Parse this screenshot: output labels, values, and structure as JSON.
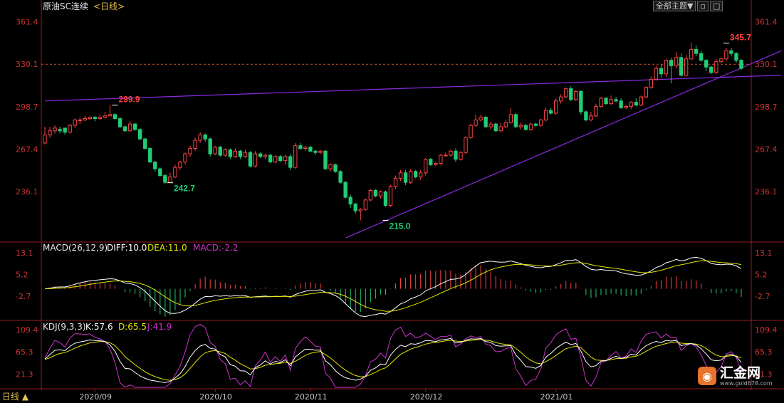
{
  "header": {
    "symbol": "原油SC连续",
    "period": "<日线>",
    "theme_label": "全部主题▼",
    "icon_names": [
      "restore-icon",
      "maximize-icon"
    ]
  },
  "bottom_tab": "日线 ▲",
  "logo": {
    "name": "汇金网",
    "url": "www.gold678.com"
  },
  "colors": {
    "up": "#ff4444",
    "down": "#22cc77",
    "trend": "#8a2be2",
    "diff": "#ffffff",
    "dea": "#e6e600",
    "macd_label": "#cc33cc",
    "axis": "#cc3333",
    "date": "#c8c8c8",
    "dashed": "#cc5522"
  },
  "chart_data": [
    {
      "type": "candlestick",
      "panel": "price",
      "y_ticks": [
        361.4,
        330.1,
        298.7,
        267.4,
        236.1
      ],
      "ylim": [
        200,
        368
      ],
      "current_price_line": 330.1,
      "annotations": [
        {
          "text": "299.9",
          "value": 299.9,
          "index": 14,
          "kind": "high"
        },
        {
          "text": "242.7",
          "value": 242.7,
          "index": 25,
          "kind": "low"
        },
        {
          "text": "215.0",
          "value": 215.0,
          "index": 68,
          "kind": "low"
        },
        {
          "text": "345.7",
          "value": 345.7,
          "index": 136,
          "kind": "high"
        }
      ],
      "trendlines": [
        {
          "i1": 0,
          "v1": 303,
          "i2": 147,
          "v2": 322
        },
        {
          "i1": 60,
          "v1": 202,
          "i2": 147,
          "v2": 340
        }
      ],
      "candles": [
        [
          272,
          278,
          284,
          271
        ],
        [
          278,
          281,
          284,
          276
        ],
        [
          281,
          283,
          285,
          279
        ],
        [
          282,
          281,
          284,
          279
        ],
        [
          283,
          280,
          283,
          278
        ],
        [
          280,
          285,
          286,
          279
        ],
        [
          285,
          289,
          290,
          283
        ],
        [
          289,
          289,
          291,
          286
        ],
        [
          289,
          290,
          292,
          288
        ],
        [
          290,
          291,
          292,
          289
        ],
        [
          291,
          290,
          292,
          288
        ],
        [
          290,
          291,
          293,
          289
        ],
        [
          291,
          292,
          295,
          290
        ],
        [
          292,
          293,
          300,
          292
        ],
        [
          293,
          290,
          294,
          289
        ],
        [
          290,
          284,
          291,
          283
        ],
        [
          284,
          281,
          285,
          280
        ],
        [
          281,
          286,
          288,
          280
        ],
        [
          286,
          282,
          287,
          281
        ],
        [
          282,
          275,
          283,
          274
        ],
        [
          275,
          268,
          276,
          267
        ],
        [
          268,
          258,
          269,
          257
        ],
        [
          258,
          253,
          259,
          251
        ],
        [
          253,
          248,
          254,
          247
        ],
        [
          248,
          243,
          249,
          242
        ],
        [
          243,
          247,
          250,
          243
        ],
        [
          247,
          254,
          256,
          246
        ],
        [
          254,
          258,
          259,
          252
        ],
        [
          258,
          264,
          265,
          256
        ],
        [
          264,
          268,
          270,
          262
        ],
        [
          268,
          274,
          276,
          266
        ],
        [
          274,
          278,
          280,
          272
        ],
        [
          278,
          275,
          279,
          273
        ],
        [
          275,
          264,
          276,
          262
        ],
        [
          264,
          269,
          270,
          263
        ],
        [
          269,
          263,
          270,
          262
        ],
        [
          263,
          267,
          268,
          262
        ],
        [
          267,
          262,
          268,
          260
        ],
        [
          262,
          266,
          268,
          261
        ],
        [
          266,
          262,
          267,
          260
        ],
        [
          262,
          265,
          267,
          261
        ],
        [
          265,
          255,
          266,
          254
        ],
        [
          255,
          264,
          266,
          254
        ],
        [
          264,
          262,
          265,
          261
        ],
        [
          262,
          263,
          264,
          260
        ],
        [
          263,
          258,
          264,
          257
        ],
        [
          258,
          262,
          263,
          257
        ],
        [
          262,
          259,
          263,
          258
        ],
        [
          259,
          262,
          263,
          256
        ],
        [
          262,
          254,
          264,
          252
        ],
        [
          254,
          270,
          272,
          253
        ],
        [
          270,
          268,
          272,
          267
        ],
        [
          268,
          269,
          270,
          266
        ],
        [
          269,
          266,
          270,
          265
        ],
        [
          266,
          265,
          267,
          263
        ],
        [
          265,
          266,
          267,
          264
        ],
        [
          266,
          253,
          267,
          252
        ],
        [
          253,
          256,
          257,
          251
        ],
        [
          256,
          251,
          257,
          250
        ],
        [
          251,
          243,
          252,
          242
        ],
        [
          243,
          232,
          244,
          231
        ],
        [
          232,
          227,
          234,
          224
        ],
        [
          227,
          222,
          228,
          220
        ],
        [
          222,
          223,
          224,
          215
        ],
        [
          223,
          230,
          231,
          222
        ],
        [
          230,
          237,
          238,
          229
        ],
        [
          237,
          233,
          238,
          232
        ],
        [
          233,
          236,
          237,
          231
        ],
        [
          236,
          226,
          237,
          225
        ],
        [
          226,
          240,
          241,
          225
        ],
        [
          240,
          246,
          248,
          238
        ],
        [
          246,
          250,
          252,
          244
        ],
        [
          250,
          243,
          252,
          241
        ],
        [
          243,
          251,
          253,
          242
        ],
        [
          251,
          247,
          252,
          246
        ],
        [
          247,
          250,
          252,
          245
        ],
        [
          250,
          260,
          261,
          248
        ],
        [
          260,
          256,
          261,
          255
        ],
        [
          256,
          257,
          258,
          255
        ],
        [
          257,
          263,
          264,
          256
        ],
        [
          263,
          263,
          265,
          262
        ],
        [
          263,
          266,
          267,
          262
        ],
        [
          266,
          260,
          268,
          258
        ],
        [
          260,
          265,
          266,
          259
        ],
        [
          265,
          276,
          277,
          264
        ],
        [
          276,
          285,
          286,
          275
        ],
        [
          285,
          289,
          293,
          284
        ],
        [
          289,
          291,
          293,
          288
        ],
        [
          291,
          284,
          292,
          283
        ],
        [
          284,
          286,
          288,
          282
        ],
        [
          286,
          281,
          287,
          280
        ],
        [
          281,
          284,
          287,
          280
        ],
        [
          284,
          287,
          289,
          283
        ],
        [
          287,
          293,
          298,
          286
        ],
        [
          293,
          284,
          294,
          283
        ],
        [
          284,
          285,
          287,
          282
        ],
        [
          285,
          282,
          286,
          281
        ],
        [
          282,
          286,
          287,
          281
        ],
        [
          286,
          285,
          287,
          284
        ],
        [
          285,
          289,
          290,
          284
        ],
        [
          289,
          296,
          298,
          288
        ],
        [
          296,
          294,
          298,
          293
        ],
        [
          294,
          303,
          305,
          293
        ],
        [
          303,
          306,
          308,
          301
        ],
        [
          306,
          312,
          313,
          305
        ],
        [
          312,
          304,
          314,
          303
        ],
        [
          304,
          310,
          311,
          303
        ],
        [
          310,
          295,
          311,
          293
        ],
        [
          295,
          289,
          296,
          288
        ],
        [
          289,
          292,
          295,
          288
        ],
        [
          292,
          299,
          301,
          291
        ],
        [
          299,
          305,
          306,
          298
        ],
        [
          305,
          301,
          306,
          300
        ],
        [
          301,
          304,
          307,
          300
        ],
        [
          304,
          303,
          306,
          302
        ],
        [
          303,
          298,
          305,
          297
        ],
        [
          298,
          299,
          300,
          297
        ],
        [
          299,
          302,
          303,
          297
        ],
        [
          302,
          300,
          305,
          299
        ],
        [
          300,
          306,
          307,
          299
        ],
        [
          306,
          313,
          314,
          305
        ],
        [
          313,
          319,
          321,
          312
        ],
        [
          319,
          327,
          329,
          318
        ],
        [
          327,
          323,
          330,
          320
        ],
        [
          323,
          333,
          334,
          321
        ],
        [
          333,
          329,
          335,
          316
        ],
        [
          329,
          335,
          339,
          327
        ],
        [
          335,
          322,
          338,
          321
        ],
        [
          322,
          334,
          337,
          321
        ],
        [
          334,
          341,
          346,
          333
        ],
        [
          341,
          338,
          344,
          336
        ],
        [
          338,
          333,
          340,
          332
        ],
        [
          333,
          328,
          334,
          325
        ],
        [
          328,
          324,
          329,
          323
        ],
        [
          324,
          332,
          334,
          323
        ],
        [
          332,
          334,
          335,
          331
        ],
        [
          334,
          340,
          342,
          333
        ],
        [
          340,
          338,
          342,
          336
        ],
        [
          338,
          333,
          339,
          331
        ],
        [
          333,
          327,
          334,
          326
        ]
      ]
    },
    {
      "type": "line",
      "panel": "macd",
      "label": "MACD(26,12,9)",
      "values_text": {
        "diff": "DIFF:10.0",
        "dea": "DEA:11.0",
        "macd": "MACD:-2.2"
      },
      "y_ticks": [
        13.1,
        5.2,
        -2.7
      ],
      "ylim": [
        -11,
        16
      ]
    },
    {
      "type": "line",
      "panel": "kdj",
      "label": "KDJ(9,3,3)",
      "values_text": {
        "k": "K:57.6",
        "d": "D:65.5",
        "j": "J:41.9"
      },
      "y_ticks": [
        109.4,
        65.3,
        21.3
      ],
      "ylim": [
        -5,
        125
      ]
    }
  ],
  "x_axis": {
    "dates": [
      {
        "label": "2020/09",
        "index": 10
      },
      {
        "label": "2020/10",
        "index": 34
      },
      {
        "label": "2020/11",
        "index": 53
      },
      {
        "label": "2020/12",
        "index": 76
      },
      {
        "label": "2021/01",
        "index": 102
      }
    ]
  }
}
